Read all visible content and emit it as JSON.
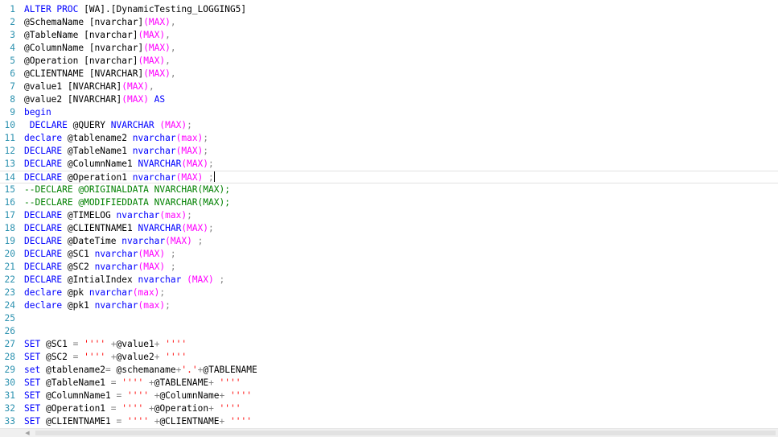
{
  "editor": {
    "colors": {
      "keyword": "#0000ff",
      "function": "#ff00ff",
      "string": "#ff0000",
      "comment": "#008000",
      "operator": "#808080",
      "line_number": "#2b91af"
    },
    "current_line": 14,
    "lines": [
      {
        "n": "1",
        "tokens": [
          [
            "kw",
            "ALTER PROC"
          ],
          [
            "tx",
            " [WA].[DynamicTesting_LOGGING5]"
          ]
        ]
      },
      {
        "n": "2",
        "tokens": [
          [
            "tx",
            "@SchemaName [nvarchar]"
          ],
          [
            "fn",
            "(MAX)"
          ],
          [
            "op",
            ","
          ]
        ]
      },
      {
        "n": "3",
        "tokens": [
          [
            "tx",
            "@TableName [nvarchar]"
          ],
          [
            "fn",
            "(MAX)"
          ],
          [
            "op",
            ","
          ]
        ]
      },
      {
        "n": "4",
        "tokens": [
          [
            "tx",
            "@ColumnName [nvarchar]"
          ],
          [
            "fn",
            "(MAX)"
          ],
          [
            "op",
            ","
          ]
        ]
      },
      {
        "n": "5",
        "tokens": [
          [
            "tx",
            "@Operation [nvarchar]"
          ],
          [
            "fn",
            "(MAX)"
          ],
          [
            "op",
            ","
          ]
        ]
      },
      {
        "n": "6",
        "tokens": [
          [
            "tx",
            "@CLIENTNAME [NVARCHAR]"
          ],
          [
            "fn",
            "(MAX)"
          ],
          [
            "op",
            ","
          ]
        ]
      },
      {
        "n": "7",
        "tokens": [
          [
            "tx",
            "@value1 [NVARCHAR]"
          ],
          [
            "fn",
            "(MAX)"
          ],
          [
            "op",
            ","
          ]
        ]
      },
      {
        "n": "8",
        "tokens": [
          [
            "tx",
            "@value2 [NVARCHAR]"
          ],
          [
            "fn",
            "(MAX)"
          ],
          [
            "kw",
            " AS"
          ]
        ]
      },
      {
        "n": "9",
        "tokens": [
          [
            "kw",
            "begin"
          ]
        ]
      },
      {
        "n": "10",
        "tokens": [
          [
            "kw",
            " DECLARE"
          ],
          [
            "tx",
            " @QUERY "
          ],
          [
            "kw",
            "NVARCHAR"
          ],
          [
            "fn",
            " (MAX)"
          ],
          [
            "op",
            ";"
          ]
        ]
      },
      {
        "n": "11",
        "tokens": [
          [
            "kw",
            "declare"
          ],
          [
            "tx",
            " @tablename2 "
          ],
          [
            "kw",
            "nvarchar"
          ],
          [
            "fn",
            "(max)"
          ],
          [
            "op",
            ";"
          ]
        ]
      },
      {
        "n": "12",
        "tokens": [
          [
            "kw",
            "DECLARE"
          ],
          [
            "tx",
            " @TableName1 "
          ],
          [
            "kw",
            "nvarchar"
          ],
          [
            "fn",
            "(MAX)"
          ],
          [
            "op",
            ";"
          ]
        ]
      },
      {
        "n": "13",
        "tokens": [
          [
            "kw",
            "DECLARE"
          ],
          [
            "tx",
            " @ColumnName1 "
          ],
          [
            "kw",
            "NVARCHAR"
          ],
          [
            "fn",
            "(MAX)"
          ],
          [
            "op",
            ";"
          ]
        ]
      },
      {
        "n": "14",
        "tokens": [
          [
            "kw",
            "DECLARE"
          ],
          [
            "tx",
            " @Operation1 "
          ],
          [
            "kw",
            "nvarchar"
          ],
          [
            "fn",
            "(MAX)"
          ],
          [
            "op",
            " ;"
          ],
          [
            "caret",
            ""
          ]
        ]
      },
      {
        "n": "15",
        "tokens": [
          [
            "cm",
            "--DECLARE @ORIGINALDATA NVARCHAR(MAX);"
          ]
        ]
      },
      {
        "n": "16",
        "tokens": [
          [
            "cm",
            "--DECLARE @MODIFIEDDATA NVARCHAR(MAX);"
          ]
        ]
      },
      {
        "n": "17",
        "tokens": [
          [
            "kw",
            "DECLARE"
          ],
          [
            "tx",
            " @TIMELOG "
          ],
          [
            "kw",
            "nvarchar"
          ],
          [
            "fn",
            "(max)"
          ],
          [
            "op",
            ";"
          ]
        ]
      },
      {
        "n": "18",
        "tokens": [
          [
            "kw",
            "DECLARE"
          ],
          [
            "tx",
            " @CLIENTNAME1 "
          ],
          [
            "kw",
            "NVARCHAR"
          ],
          [
            "fn",
            "(MAX)"
          ],
          [
            "op",
            ";"
          ]
        ]
      },
      {
        "n": "19",
        "tokens": [
          [
            "kw",
            "DECLARE"
          ],
          [
            "tx",
            " @DateTime "
          ],
          [
            "kw",
            "nvarchar"
          ],
          [
            "fn",
            "(MAX)"
          ],
          [
            "op",
            " ;"
          ]
        ]
      },
      {
        "n": "20",
        "tokens": [
          [
            "kw",
            "DECLARE"
          ],
          [
            "tx",
            " @SC1 "
          ],
          [
            "kw",
            "nvarchar"
          ],
          [
            "fn",
            "(MAX)"
          ],
          [
            "op",
            " ;"
          ]
        ]
      },
      {
        "n": "21",
        "tokens": [
          [
            "kw",
            "DECLARE"
          ],
          [
            "tx",
            " @SC2 "
          ],
          [
            "kw",
            "nvarchar"
          ],
          [
            "fn",
            "(MAX)"
          ],
          [
            "op",
            " ;"
          ]
        ]
      },
      {
        "n": "22",
        "tokens": [
          [
            "kw",
            "DECLARE"
          ],
          [
            "tx",
            " @IntialIndex "
          ],
          [
            "kw",
            "nvarchar"
          ],
          [
            "fn",
            " (MAX)"
          ],
          [
            "op",
            " ;"
          ]
        ]
      },
      {
        "n": "23",
        "tokens": [
          [
            "kw",
            "declare"
          ],
          [
            "tx",
            " @pk "
          ],
          [
            "kw",
            "nvarchar"
          ],
          [
            "fn",
            "(max)"
          ],
          [
            "op",
            ";"
          ]
        ]
      },
      {
        "n": "24",
        "tokens": [
          [
            "kw",
            "declare"
          ],
          [
            "tx",
            " @pk1 "
          ],
          [
            "kw",
            "nvarchar"
          ],
          [
            "fn",
            "(max)"
          ],
          [
            "op",
            ";"
          ]
        ]
      },
      {
        "n": "25",
        "tokens": []
      },
      {
        "n": "26",
        "tokens": []
      },
      {
        "n": "27",
        "tokens": [
          [
            "kw",
            "SET"
          ],
          [
            "tx",
            " @SC1 "
          ],
          [
            "op",
            "="
          ],
          [
            "str",
            " ''''"
          ],
          [
            "op",
            " +"
          ],
          [
            "tx",
            "@value1"
          ],
          [
            "op",
            "+"
          ],
          [
            "str",
            " ''''"
          ]
        ]
      },
      {
        "n": "28",
        "tokens": [
          [
            "kw",
            "SET"
          ],
          [
            "tx",
            " @SC2 "
          ],
          [
            "op",
            "="
          ],
          [
            "str",
            " ''''"
          ],
          [
            "op",
            " +"
          ],
          [
            "tx",
            "@value2"
          ],
          [
            "op",
            "+"
          ],
          [
            "str",
            " ''''"
          ]
        ]
      },
      {
        "n": "29",
        "tokens": [
          [
            "kw",
            "set"
          ],
          [
            "tx",
            " @tablename2"
          ],
          [
            "op",
            "="
          ],
          [
            "tx",
            " @schemaname"
          ],
          [
            "op",
            "+"
          ],
          [
            "str",
            "'.'"
          ],
          [
            "op",
            "+"
          ],
          [
            "tx",
            "@TABLENAME"
          ]
        ]
      },
      {
        "n": "30",
        "tokens": [
          [
            "kw",
            "SET"
          ],
          [
            "tx",
            " @TableName1 "
          ],
          [
            "op",
            "="
          ],
          [
            "str",
            " ''''"
          ],
          [
            "op",
            " +"
          ],
          [
            "tx",
            "@TABLENAME"
          ],
          [
            "op",
            "+"
          ],
          [
            "str",
            " ''''"
          ]
        ]
      },
      {
        "n": "31",
        "tokens": [
          [
            "kw",
            "SET"
          ],
          [
            "tx",
            " @ColumnName1 "
          ],
          [
            "op",
            "="
          ],
          [
            "str",
            " ''''"
          ],
          [
            "op",
            " +"
          ],
          [
            "tx",
            "@ColumnName"
          ],
          [
            "op",
            "+"
          ],
          [
            "str",
            " ''''"
          ]
        ]
      },
      {
        "n": "32",
        "tokens": [
          [
            "kw",
            "SET"
          ],
          [
            "tx",
            " @Operation1 "
          ],
          [
            "op",
            "="
          ],
          [
            "str",
            " ''''"
          ],
          [
            "op",
            " +"
          ],
          [
            "tx",
            "@Operation"
          ],
          [
            "op",
            "+"
          ],
          [
            "str",
            " ''''"
          ]
        ]
      },
      {
        "n": "33",
        "tokens": [
          [
            "kw",
            "SET"
          ],
          [
            "tx",
            " @CLIENTNAME1 "
          ],
          [
            "op",
            "="
          ],
          [
            "str",
            " ''''"
          ],
          [
            "op",
            " +"
          ],
          [
            "tx",
            "@CLIENTNAME"
          ],
          [
            "op",
            "+"
          ],
          [
            "str",
            " ''''"
          ]
        ]
      }
    ]
  },
  "scrollbar": {
    "left_arrow_icon": "triangle-left-icon",
    "left_arrow_glyph": "◀"
  }
}
